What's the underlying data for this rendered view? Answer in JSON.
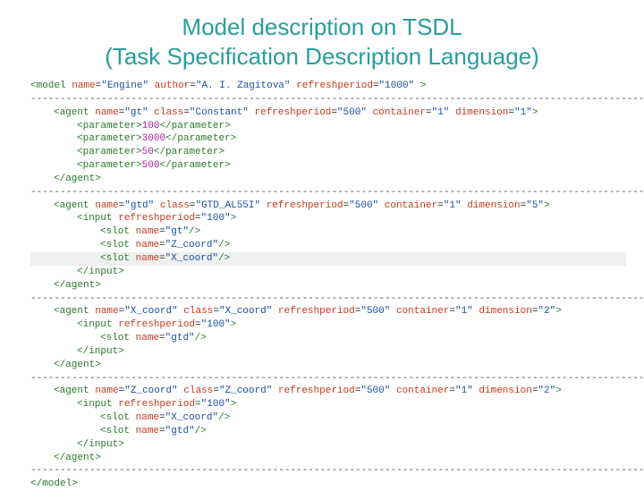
{
  "title_line1": "Model description on TSDL",
  "title_line2": "(Task Specification Description Language)",
  "dash_line": "---------------------------------------------------------------------------------------------------------",
  "model": {
    "name": "Engine",
    "author": "A. I. Zagitova",
    "refreshperiod": "1000"
  },
  "agents": [
    {
      "name": "gt",
      "class": "Constant",
      "refreshperiod": "500",
      "container": "1",
      "dimension": "1",
      "parameters": [
        "100",
        "3000",
        "50",
        "500"
      ]
    },
    {
      "name": "gtd",
      "class": "GTD_AL55I",
      "refreshperiod": "500",
      "container": "1",
      "dimension": "5",
      "input_refreshperiod": "100",
      "slots": [
        "gt",
        "Z_coord",
        "X_coord"
      ],
      "highlight_slot_index": 2
    },
    {
      "name": "X_coord",
      "class": "X_coord",
      "refreshperiod": "500",
      "container": "1",
      "dimension": "2",
      "input_refreshperiod": "100",
      "slots": [
        "gtd"
      ]
    },
    {
      "name": "Z_coord",
      "class": "Z_coord",
      "refreshperiod": "500",
      "container": "1",
      "dimension": "2",
      "input_refreshperiod": "100",
      "slots": [
        "X_coord",
        "gtd"
      ]
    }
  ],
  "kw": {
    "model": "model",
    "agent": "agent",
    "parameter": "parameter",
    "input": "input",
    "slot": "slot",
    "name": "name",
    "author": "author",
    "refreshperiod": "refreshperiod",
    "class": "class",
    "container": "container",
    "dimension": "dimension"
  }
}
